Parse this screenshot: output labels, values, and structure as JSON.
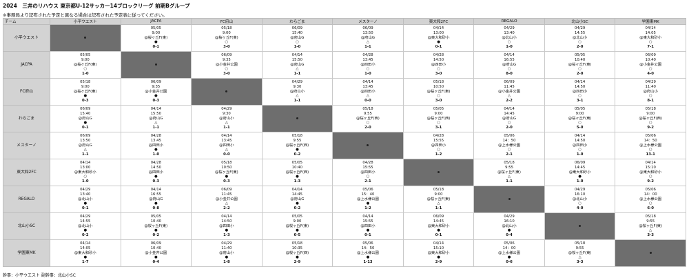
{
  "title": "2024　三井のリハウス 東京都U-12サッカー14ブロックリーグ 前期Bグループ",
  "note": "※事務局より記布された予定と異なる場合は記布された予定表に従ってください。",
  "corner_label": "チーム",
  "teams": [
    "小平ウエスト",
    "JACPA",
    "FC府山",
    "わらごま",
    "メスターノ",
    "東大和2FC",
    "REGALO",
    "北山小SC",
    "学園東MK"
  ],
  "rows": [
    {
      "team": "小平ウエスト",
      "cells": [
        null,
        {
          "date": "05/05",
          "time": "9:00",
          "venue": "@桜ヶ丘F(東)",
          "mark": "●",
          "score": "0-1"
        },
        {
          "date": "05/18",
          "time": "9:00",
          "venue": "@桜ヶ丘F(東)",
          "mark": "○",
          "score": "3-0"
        },
        {
          "date": "06/09",
          "time": "15:40",
          "venue": "@府山G",
          "mark": "○",
          "score": "1-0"
        },
        {
          "date": "06/09",
          "time": "13:50",
          "venue": "@府山G",
          "mark": "△",
          "score": "1-1"
        },
        {
          "date": "04/14",
          "time": "13:00",
          "venue": "@東大和砂小",
          "mark": "●",
          "score": "0-1"
        },
        {
          "date": "04/29",
          "time": "13:40",
          "venue": "@北山小",
          "mark": "○",
          "score": "1-0"
        },
        {
          "date": "04/29",
          "time": "14:55",
          "venue": "@北山小",
          "mark": "○",
          "score": "2-0"
        },
        {
          "date": "04/14",
          "time": "14:05",
          "venue": "@東大和砂小",
          "mark": "○",
          "score": "7-1"
        }
      ]
    },
    {
      "team": "JACPA",
      "cells": [
        {
          "date": "05/05",
          "time": "9:00",
          "venue": "@桜ヶ丘F(東)",
          "mark": "○",
          "score": "1-0"
        },
        null,
        {
          "date": "06/09",
          "time": "9:35",
          "venue": "@小金井公園",
          "mark": "○",
          "score": "3-0"
        },
        {
          "date": "04/14",
          "time": "15:50",
          "venue": "@府山G",
          "mark": "△",
          "score": "1-1"
        },
        {
          "date": "04/28",
          "time": "13:45",
          "venue": "@四田小",
          "mark": "○",
          "score": "1-0"
        },
        {
          "date": "04/28",
          "time": "14:50",
          "venue": "@四田小",
          "mark": "○",
          "score": "3-0"
        },
        {
          "date": "04/14",
          "time": "16:55",
          "venue": "@府山G",
          "mark": "○",
          "score": "8-0"
        },
        {
          "date": "05/05",
          "time": "10:40",
          "venue": "@桜ヶ丘F(東)",
          "mark": "○",
          "score": "2-0"
        },
        {
          "date": "06/09",
          "time": "10:40",
          "venue": "@小金井公園",
          "mark": "○",
          "score": "4-0"
        }
      ]
    },
    {
      "team": "FC府山",
      "cells": [
        {
          "date": "05/18",
          "time": "9:00",
          "venue": "@桜ヶ丘F(東)",
          "mark": "●",
          "score": "0-3"
        },
        {
          "date": "06/09",
          "time": "9:35",
          "venue": "@小金井公園",
          "mark": "●",
          "score": "0-3"
        },
        null,
        {
          "date": "04/29",
          "time": "9:30",
          "venue": "@府山小",
          "mark": "△",
          "score": "1-1"
        },
        {
          "date": "04/14",
          "time": "13:45",
          "venue": "@四田小",
          "mark": "△",
          "score": "0-0"
        },
        {
          "date": "05/18",
          "time": "10:50",
          "venue": "@桜ヶ丘F(東)",
          "mark": "○",
          "score": "3-0"
        },
        {
          "date": "06/09",
          "time": "11:45",
          "venue": "@小金井公園",
          "mark": "△",
          "score": "2-2"
        },
        {
          "date": "04/14",
          "time": "14:50",
          "venue": "@四田小",
          "mark": "○",
          "score": "3-1"
        },
        {
          "date": "04/29",
          "time": "11:40",
          "venue": "@府山小",
          "mark": "○",
          "score": "8-1"
        }
      ]
    },
    {
      "team": "わらごま",
      "cells": [
        {
          "date": "06/09",
          "time": "15:40",
          "venue": "@府山G",
          "mark": "●",
          "score": "0-1"
        },
        {
          "date": "04/14",
          "time": "15:50",
          "venue": "@府山G",
          "mark": "△",
          "score": "1-1"
        },
        {
          "date": "04/29",
          "time": "9:30",
          "venue": "@府山小",
          "mark": "△",
          "score": "1-1"
        },
        null,
        {
          "date": "05/18",
          "time": "9:55",
          "venue": "@桜ヶ丘F(西)",
          "mark": "○",
          "score": "2-0"
        },
        {
          "date": "05/05",
          "time": "9:00",
          "venue": "@桜ヶ丘F(西)",
          "mark": "○",
          "score": "3-1"
        },
        {
          "date": "04/14",
          "time": "14:45",
          "venue": "@府山G",
          "mark": "○",
          "score": "2-0"
        },
        {
          "date": "05/05",
          "time": "9:00",
          "venue": "@桜ヶ丘F(東)",
          "mark": "○",
          "score": "5-0"
        },
        {
          "date": "05/18",
          "time": "9:00",
          "venue": "@桜ヶ丘F(西)",
          "mark": "○",
          "score": "9-2"
        }
      ]
    },
    {
      "team": "メスターノ",
      "cells": [
        {
          "date": "06/09",
          "time": "13:50",
          "venue": "@府山G",
          "mark": "△",
          "score": "1-1"
        },
        {
          "date": "04/28",
          "time": "13:45",
          "venue": "@四田小",
          "mark": "●",
          "score": "1-0"
        },
        {
          "date": "04/14",
          "time": "13:45",
          "venue": "@四田小",
          "mark": "△",
          "score": "0-0"
        },
        {
          "date": "05/18",
          "time": "9:55",
          "venue": "@桜ヶ丘F(西)",
          "mark": "●",
          "score": "0-2"
        },
        null,
        {
          "date": "04/28",
          "time": "15:55",
          "venue": "@四田小",
          "mark": "○",
          "score": "1-2"
        },
        {
          "date": "05/06",
          "time": "14：50",
          "venue": "@上水様公園",
          "mark": "○",
          "score": "2-1"
        },
        {
          "date": "04/14",
          "time": "14:50",
          "venue": "@四田小",
          "mark": "○",
          "score": "1-0"
        },
        {
          "date": "05/06",
          "time": "14：50",
          "venue": "@上水様公園",
          "mark": "○",
          "score": "13-1"
        }
      ]
    },
    {
      "team": "東大和2FC",
      "cells": [
        {
          "date": "04/14",
          "time": "13:00",
          "venue": "@東大和砂小",
          "mark": "○",
          "score": "1-0"
        },
        {
          "date": "04/28",
          "time": "14:50",
          "venue": "@四田小",
          "mark": "●",
          "score": "0-3"
        },
        {
          "date": "05/18",
          "time": "10:50",
          "venue": "@桜ヶ丘F(東)",
          "mark": "●",
          "score": "0-3"
        },
        {
          "date": "05/05",
          "time": "10:40",
          "venue": "@桜ヶ丘F(西)",
          "mark": "●",
          "score": "1-3"
        },
        {
          "date": "04/28",
          "time": "15:55",
          "venue": "@四田小",
          "mark": "○",
          "score": "2-1"
        },
        null,
        {
          "date": "05/18",
          "time": "9:55",
          "venue": "@桜ヶ丘F(東)",
          "mark": "△",
          "score": "1-1"
        },
        {
          "date": "06/09",
          "time": "14:45",
          "venue": "@東大和砂小",
          "mark": "●",
          "score": "1-0"
        },
        {
          "date": "04/14",
          "time": "15:10",
          "venue": "@東大和砂小",
          "mark": "○",
          "score": "9-2"
        }
      ]
    },
    {
      "team": "REGALO",
      "cells": [
        {
          "date": "04/29",
          "time": "13:40",
          "venue": "@北山小",
          "mark": "●",
          "score": "0-1"
        },
        {
          "date": "04/14",
          "time": "16:55",
          "venue": "@府山G",
          "mark": "●",
          "score": "0-8"
        },
        {
          "date": "06/09",
          "time": "11:45",
          "venue": "@小金井公園",
          "mark": "△",
          "score": "2-2"
        },
        {
          "date": "04/14",
          "time": "14:45",
          "venue": "@府山G",
          "mark": "●",
          "score": "0-2"
        },
        {
          "date": "05/06",
          "time": "15：40",
          "venue": "@上水様公園",
          "mark": "●",
          "score": "1-2"
        },
        {
          "date": "05/18",
          "time": "9:00",
          "venue": "@桜ヶ丘F(東)",
          "mark": "△",
          "score": "1-1"
        },
        null,
        {
          "date": "04/29",
          "time": "16:10",
          "venue": "@北山小",
          "mark": "○",
          "score": "4-0"
        },
        {
          "date": "05/06",
          "time": "14：00",
          "venue": "@上水様公園",
          "mark": "○",
          "score": "6-0"
        }
      ]
    },
    {
      "team": "北山小SC",
      "cells": [
        {
          "date": "04/29",
          "time": "14:55",
          "venue": "@北山小",
          "mark": "●",
          "score": "0-2"
        },
        {
          "date": "05/05",
          "time": "10:40",
          "venue": "@桜ヶ丘F(東)",
          "mark": "●",
          "score": "0-2"
        },
        {
          "date": "04/14",
          "time": "14:50",
          "venue": "@四田小",
          "mark": "●",
          "score": "1-3"
        },
        {
          "date": "05/05",
          "time": "9:00",
          "venue": "@桜ヶ丘F(東)",
          "mark": "●",
          "score": "0-5"
        },
        {
          "date": "04/14",
          "time": "15:55",
          "venue": "@四田小",
          "mark": "●",
          "score": "0-1"
        },
        {
          "date": "06/09",
          "time": "14:45",
          "venue": "@東大和砂小",
          "mark": "●",
          "score": "0-1"
        },
        {
          "date": "04/29",
          "time": "16:10",
          "venue": "@北山小",
          "mark": "●",
          "score": "0-4"
        },
        null,
        {
          "date": "05/18",
          "time": "9:55",
          "venue": "@桜ヶ丘F(東)",
          "mark": "△",
          "score": "3-3"
        }
      ]
    },
    {
      "team": "学園東MK",
      "cells": [
        {
          "date": "04/14",
          "time": "14:05",
          "venue": "@東大和砂小",
          "mark": "●",
          "score": "1-7"
        },
        {
          "date": "06/09",
          "time": "10:40",
          "venue": "@小金井公園",
          "mark": "●",
          "score": "0-4"
        },
        {
          "date": "04/29",
          "time": "11:40",
          "venue": "@府山小",
          "mark": "●",
          "score": "1-8"
        },
        {
          "date": "05/18",
          "time": "10:35",
          "venue": "@桜ヶ丘F(西)",
          "mark": "●",
          "score": "2-9"
        },
        {
          "date": "05/06",
          "time": "14：50",
          "venue": "@上水様公園",
          "mark": "●",
          "score": "1-13"
        },
        {
          "date": "04/14",
          "time": "15:10",
          "venue": "@東大和砂小",
          "mark": "●",
          "score": "2-9"
        },
        {
          "date": "05/06",
          "time": "14：00",
          "venue": "@上水様公園",
          "mark": "●",
          "score": "0-6"
        },
        {
          "date": "05/18",
          "time": "9:55",
          "venue": "@桜ヶ丘F(東)",
          "mark": "△",
          "score": "3-3"
        },
        null
      ]
    }
  ],
  "footer": "幹事：小平ウエスト 副幹事：北山小SC"
}
